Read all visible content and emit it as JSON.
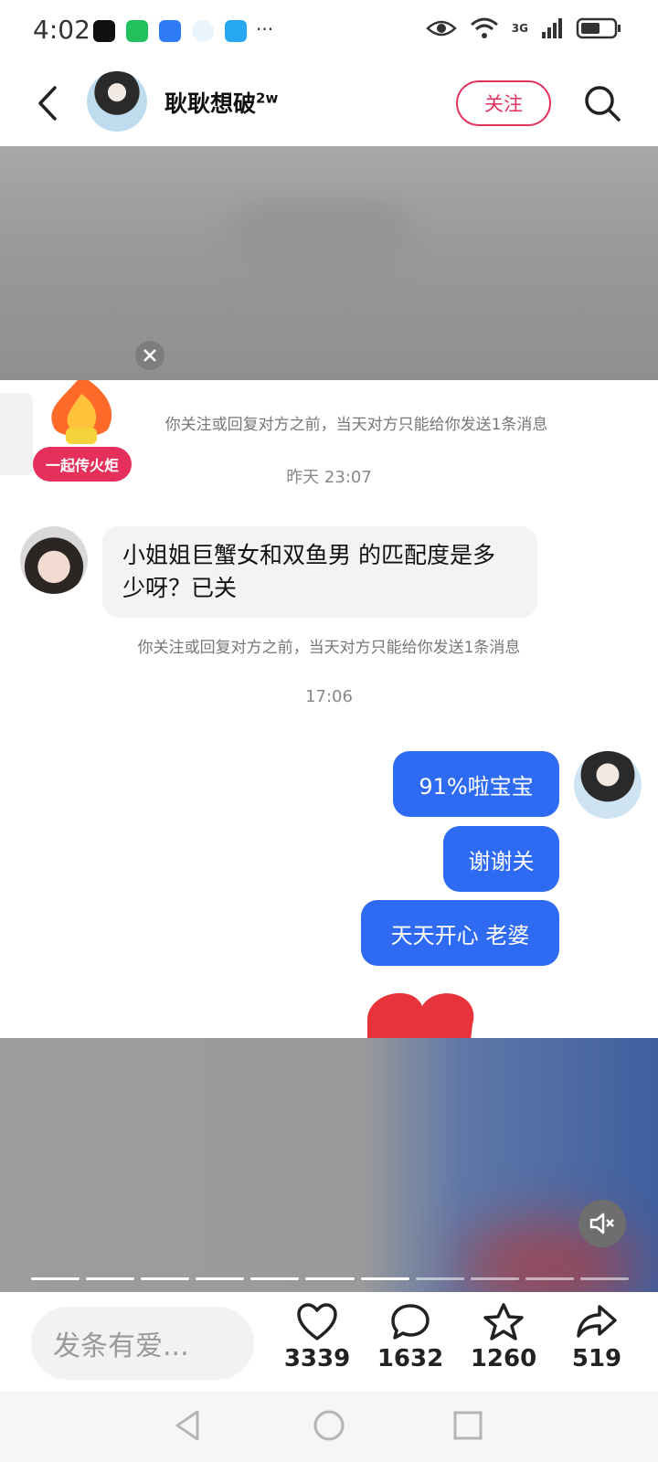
{
  "status_bar": {
    "time": "4:02",
    "more": "···",
    "network": "3G"
  },
  "header": {
    "username": "耿耿想破",
    "username_suffix": "2w",
    "follow_label": "关注"
  },
  "chat": {
    "notice_top": "你关注或回复对方之前，当天对方只能给你发送1条消息",
    "torch_label": "一起传火炬",
    "time_1": "昨天 23:07",
    "incoming_message": "小姐姐巨蟹女和双鱼男 的匹配度是多少呀？已关",
    "notice_bottom": "你关注或回复对方之前，当天对方只能给你发送1条消息",
    "time_2": "17:06",
    "outgoing": [
      "91%啦宝宝",
      "谢谢关",
      "天天开心 老婆"
    ]
  },
  "actions": {
    "comment_placeholder": "发条有爱...",
    "like_count": "3339",
    "comment_count": "1632",
    "favorite_count": "1260",
    "share_count": "519"
  },
  "colors": {
    "accent": "#e3325e",
    "bubble_blue": "#2f6bf2"
  }
}
